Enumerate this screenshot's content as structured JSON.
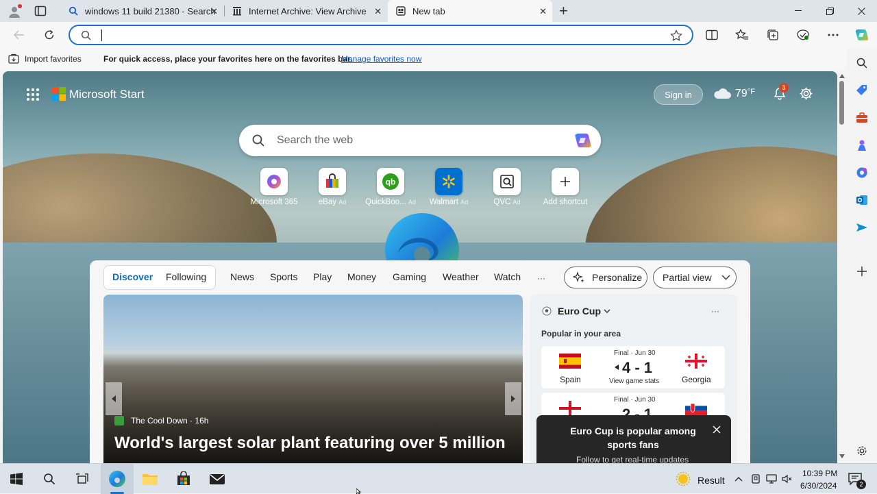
{
  "tabs": [
    {
      "title": "windows 11 build 21380 - Search",
      "close": "✕"
    },
    {
      "title": "Internet Archive: View Archive",
      "close": "✕"
    },
    {
      "title": "New tab",
      "close": "✕"
    }
  ],
  "new_tab_glyph": "+",
  "address": {
    "value": "",
    "placeholder": ""
  },
  "favorites_bar": {
    "import_label": "Import favorites",
    "hint": "For quick access, place your favorites here on the favorites bar.",
    "manage_link": "Manage favorites now"
  },
  "start": {
    "brand": "Microsoft Start",
    "sign_in": "Sign in",
    "temperature": "79",
    "temp_unit": "°F",
    "notif_count": "3",
    "search_placeholder": "Search the web"
  },
  "shortcuts": [
    {
      "label": "Microsoft 365",
      "ad": "",
      "icon": "m365-icon"
    },
    {
      "label": "eBay",
      "ad": "Ad",
      "icon": "ebay-icon"
    },
    {
      "label": "QuickBoo...",
      "ad": "Ad",
      "icon": "quickbooks-icon"
    },
    {
      "label": "Walmart",
      "ad": "Ad",
      "icon": "walmart-icon"
    },
    {
      "label": "QVC",
      "ad": "Ad",
      "icon": "qvc-icon"
    },
    {
      "label": "Add shortcut",
      "ad": "",
      "icon": "plus-icon"
    }
  ],
  "feed_tabs": {
    "discover": "Discover",
    "following": "Following",
    "items": [
      "News",
      "Sports",
      "Play",
      "Money",
      "Gaming",
      "Weather",
      "Watch"
    ],
    "more": "···",
    "personalize": "Personalize",
    "partial_view": "Partial view"
  },
  "hero": {
    "source": "The Cool Down",
    "age": "16h",
    "headline": "World's largest solar plant featuring over 5 million"
  },
  "euro": {
    "title": "Euro Cup",
    "subtitle": "Popular in your area",
    "menu": "···",
    "match1": {
      "status": "Final · Jun 30",
      "home": "Spain",
      "score": "4 - 1",
      "away": "Georgia",
      "stats": "View game stats"
    },
    "match2": {
      "status": "Final · Jun 30",
      "score": "2 - 1"
    }
  },
  "toast": {
    "title": "Euro Cup is popular among sports fans",
    "body": "Follow to get real-time updates"
  },
  "taskbar": {
    "weather_label": "Result",
    "time": "10:39 PM",
    "date": "6/30/2024",
    "notif": "2"
  },
  "colors": {
    "accent": "#1a73c8",
    "link": "#0f5cc0",
    "discover": "#0f6cbd"
  }
}
